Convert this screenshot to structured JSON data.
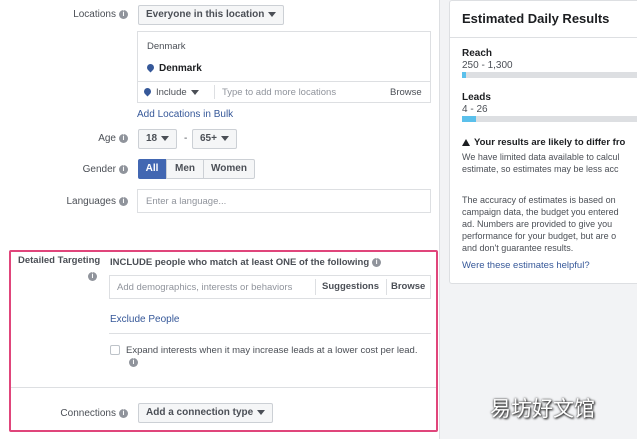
{
  "locations": {
    "label": "Locations",
    "dropdown": "Everyone in this location",
    "country_header": "Denmark",
    "selected": "Denmark",
    "include": "Include",
    "placeholder": "Type to add more locations",
    "browse": "Browse",
    "bulk_link": "Add Locations in Bulk"
  },
  "age": {
    "label": "Age",
    "min": "18",
    "dash": "-",
    "max": "65+"
  },
  "gender": {
    "label": "Gender",
    "options": [
      "All",
      "Men",
      "Women"
    ],
    "selected": "All"
  },
  "languages": {
    "label": "Languages",
    "placeholder": "Enter a language..."
  },
  "detailed_targeting": {
    "label": "Detailed Targeting",
    "include_text": "INCLUDE people who match at least ONE of the following",
    "placeholder": "Add demographics, interests or behaviors",
    "suggestions": "Suggestions",
    "browse": "Browse",
    "exclude_link": "Exclude People",
    "expand_text": "Expand interests when it may increase leads at a lower cost per lead."
  },
  "connections": {
    "label": "Connections",
    "button": "Add a connection type"
  },
  "estimate": {
    "title": "Estimated Daily Results",
    "reach_label": "Reach",
    "reach_value": "250 - 1,300",
    "reach_fill": 0.02,
    "leads_label": "Leads",
    "leads_value": "4 - 26",
    "leads_fill": 0.08,
    "warning": "Your results are likely to differ fro",
    "warning_text": "We have limited data available to calcul\nestimate, so estimates may be less acc",
    "accuracy_text": "The accuracy of estimates is based on \ncampaign data, the budget you entered\nad. Numbers are provided to give you\nperformance for your budget, but are o\nand don't guarantee results.",
    "helpful_link": "Were these estimates helpful?"
  },
  "watermark": "易坊好文馆",
  "colors": {
    "accent": "#4267b2",
    "link": "#365899",
    "highlight": "#e0457b",
    "bar": "#5bc0eb"
  },
  "icons": [
    "info-icon",
    "caret-down-icon",
    "location-pin-icon",
    "warning-icon"
  ]
}
